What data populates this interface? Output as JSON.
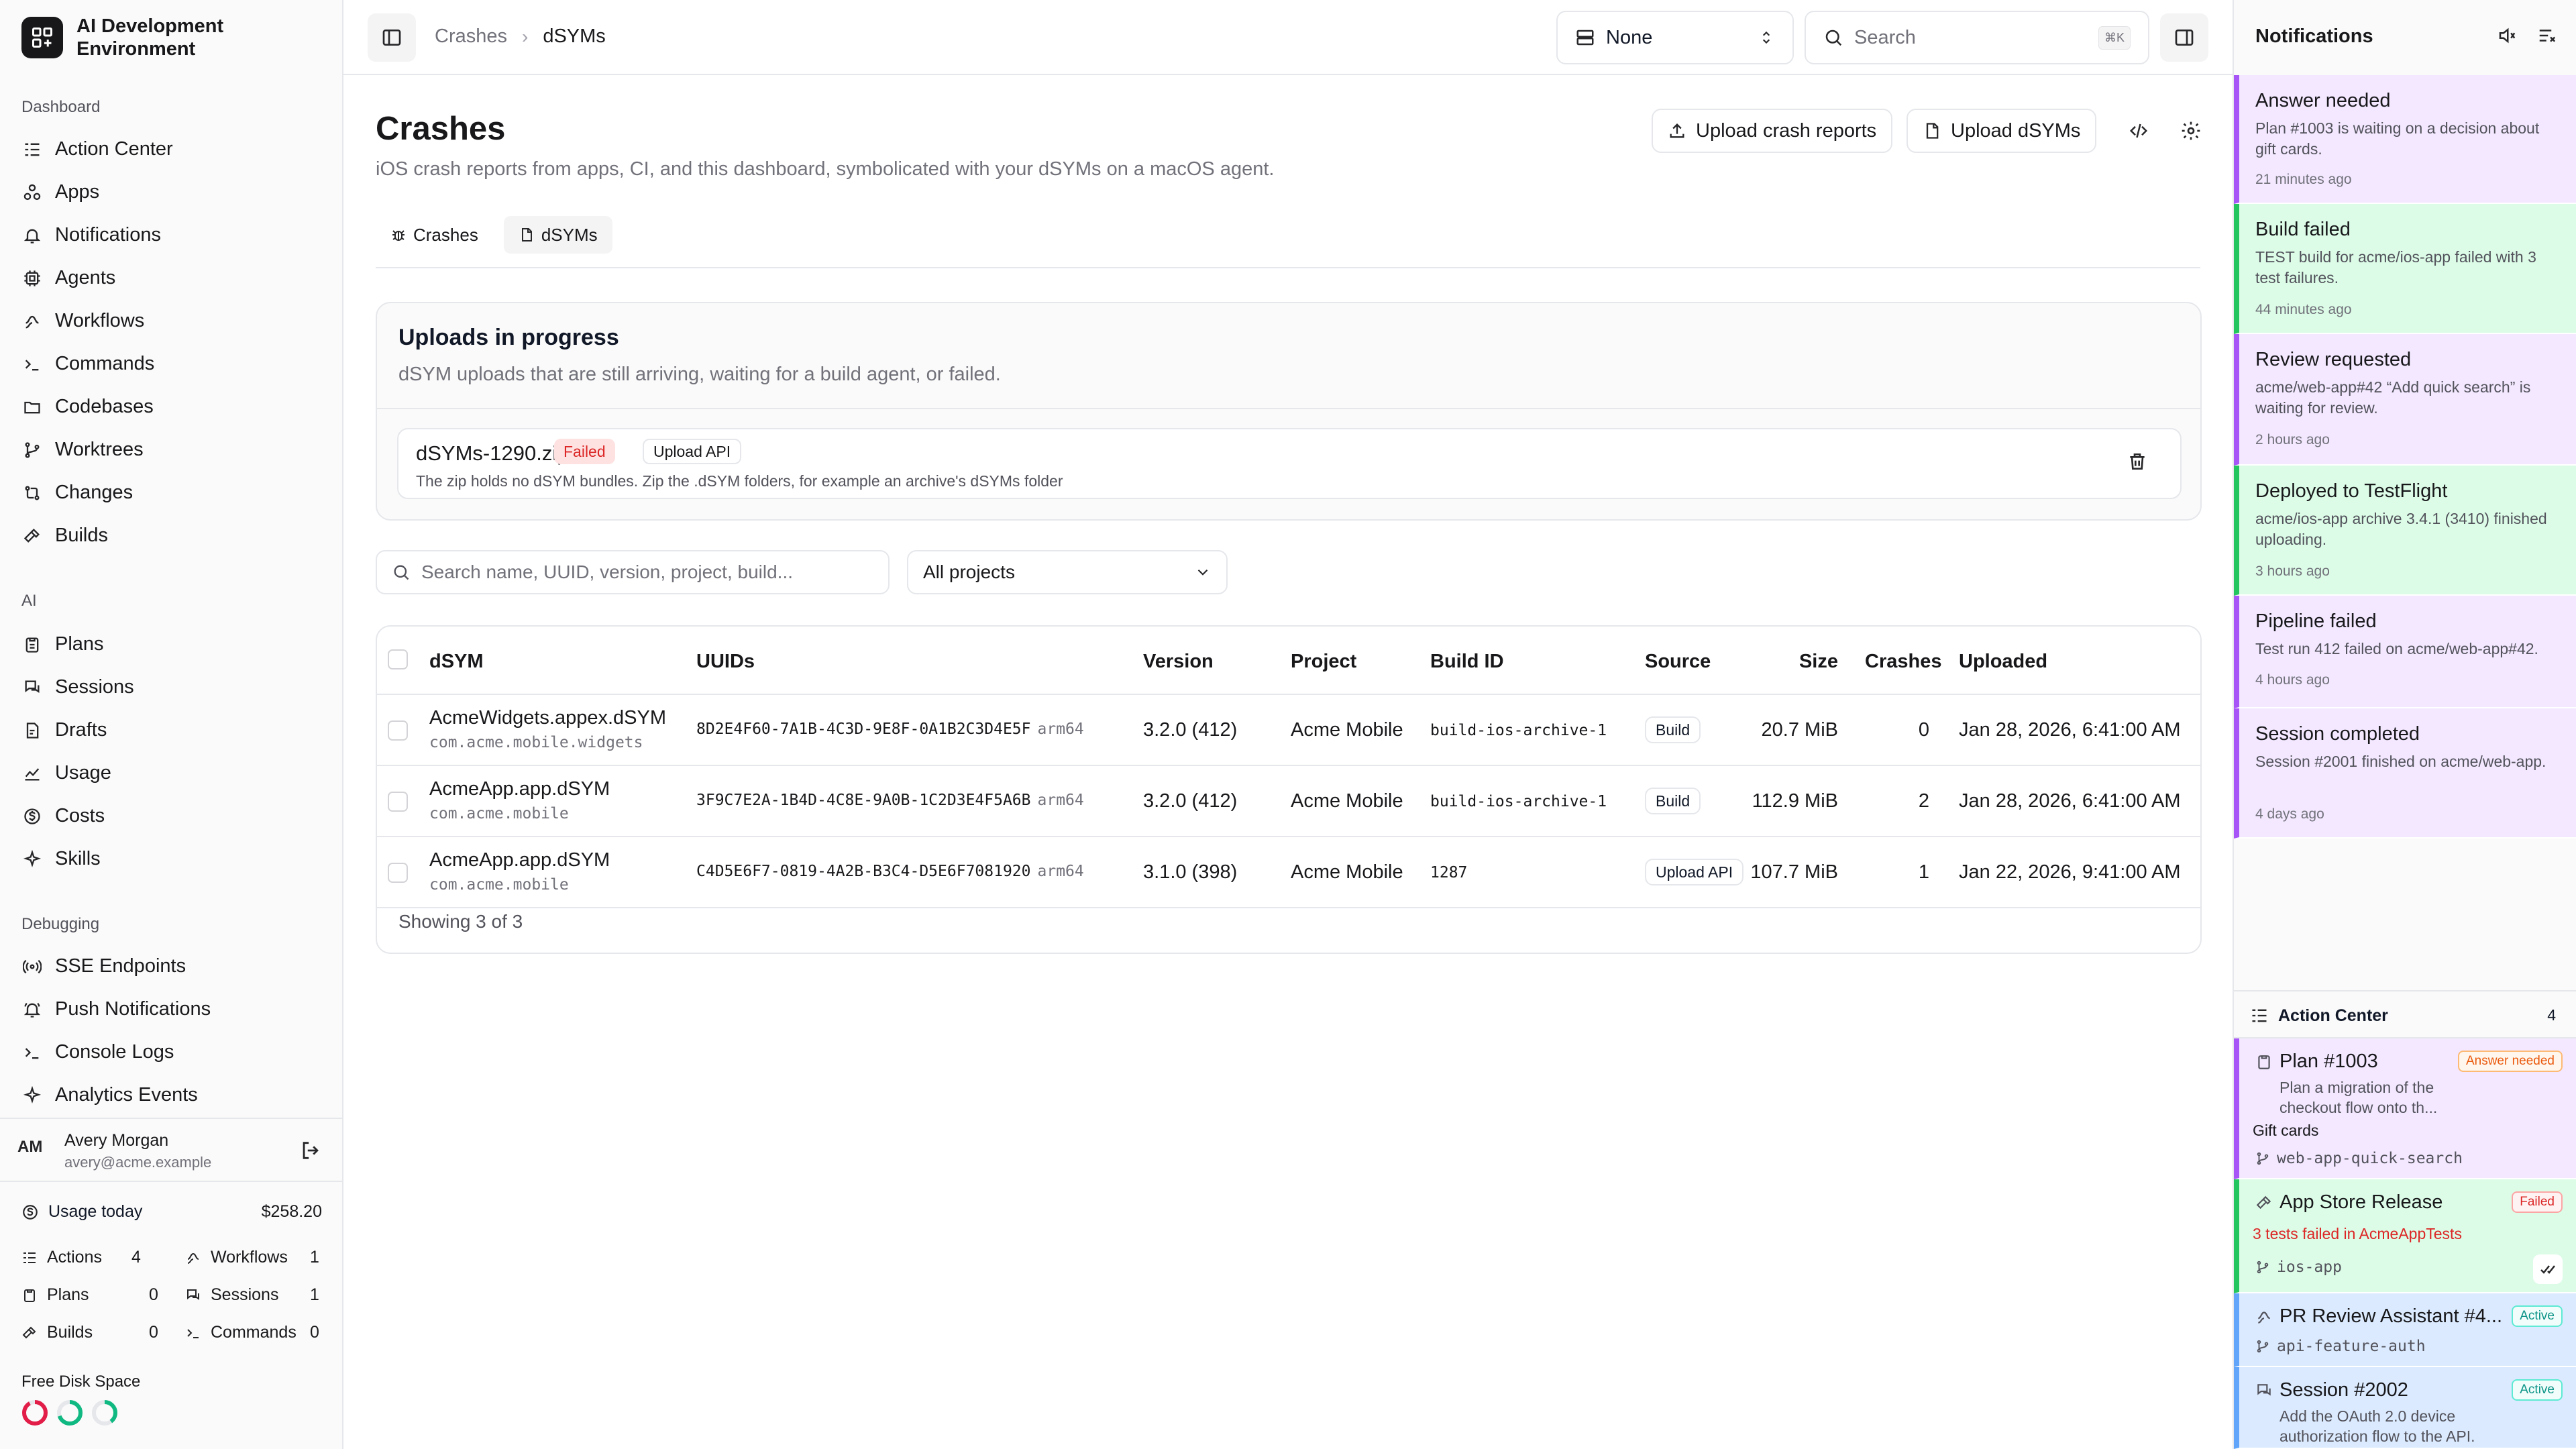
{
  "app": {
    "title": "AI Development Environment"
  },
  "sidebar": {
    "sections": [
      {
        "label": "Dashboard",
        "items": [
          {
            "label": "Action Center",
            "icon": "list-icon"
          },
          {
            "label": "Apps",
            "icon": "apps-icon"
          },
          {
            "label": "Notifications",
            "icon": "bell-icon"
          },
          {
            "label": "Agents",
            "icon": "cpu-icon"
          },
          {
            "label": "Workflows",
            "icon": "workflow-icon"
          },
          {
            "label": "Commands",
            "icon": "terminal-icon"
          },
          {
            "label": "Codebases",
            "icon": "folder-icon"
          },
          {
            "label": "Worktrees",
            "icon": "branch-icon"
          },
          {
            "label": "Changes",
            "icon": "diff-icon"
          },
          {
            "label": "Builds",
            "icon": "hammer-icon"
          }
        ]
      },
      {
        "label": "AI",
        "items": [
          {
            "label": "Plans",
            "icon": "clipboard-icon"
          },
          {
            "label": "Sessions",
            "icon": "chat-icon"
          },
          {
            "label": "Drafts",
            "icon": "draft-icon"
          },
          {
            "label": "Usage",
            "icon": "chart-icon"
          },
          {
            "label": "Costs",
            "icon": "dollar-icon"
          },
          {
            "label": "Skills",
            "icon": "sparkle-icon"
          }
        ]
      },
      {
        "label": "Debugging",
        "items": [
          {
            "label": "SSE Endpoints",
            "icon": "radio-icon"
          },
          {
            "label": "Push Notifications",
            "icon": "bell-ring-icon"
          },
          {
            "label": "Console Logs",
            "icon": "terminal-icon"
          },
          {
            "label": "Analytics Events",
            "icon": "sparkle-icon"
          }
        ]
      }
    ],
    "user": {
      "initials": "AM",
      "name": "Avery Morgan",
      "email": "avery@acme.example"
    },
    "usage": {
      "label": "Usage today",
      "amount": "$258.20"
    },
    "stats": [
      {
        "label": "Actions",
        "value": "4"
      },
      {
        "label": "Workflows",
        "value": "1"
      },
      {
        "label": "Plans",
        "value": "0"
      },
      {
        "label": "Sessions",
        "value": "1"
      },
      {
        "label": "Builds",
        "value": "0"
      },
      {
        "label": "Commands",
        "value": "0"
      }
    ],
    "disk": {
      "label": "Free Disk Space",
      "levels": [
        0.92,
        0.7,
        0.4
      ],
      "colors": [
        "#e11d48",
        "#10b981",
        "#10b981"
      ]
    }
  },
  "topbar": {
    "breadcrumb": [
      "Crashes",
      "dSYMs"
    ],
    "project_select": "None",
    "search_placeholder": "Search",
    "search_shortcut": "⌘K"
  },
  "main": {
    "title": "Crashes",
    "subtitle": "iOS crash reports from apps, CI, and this dashboard, symbolicated with your dSYMs on a macOS agent.",
    "buttons": {
      "upload_crash": "Upload crash reports",
      "upload_dsyms": "Upload dSYMs"
    },
    "tabs": [
      {
        "label": "Crashes",
        "active": false
      },
      {
        "label": "dSYMs",
        "active": true
      }
    ],
    "uploads": {
      "title": "Uploads in progress",
      "description": "dSYM uploads that are still arriving, waiting for a build agent, or failed.",
      "items": [
        {
          "name": "dSYMs-1290.zip",
          "status": "Failed",
          "source": "Upload API",
          "message": "The zip holds no dSYM bundles. Zip the .dSYM folders, for example an archive's dSYMs folder"
        }
      ]
    },
    "filters": {
      "search_placeholder": "Search name, UUID, version, project, build...",
      "project": "All projects"
    },
    "table": {
      "columns": [
        "dSYM",
        "UUIDs",
        "Version",
        "Project",
        "Build ID",
        "Source",
        "Size",
        "Crashes",
        "Uploaded"
      ],
      "rows": [
        {
          "name": "AcmeWidgets.appex.dSYM",
          "bundle": "com.acme.mobile.widgets",
          "uuid": "8D2E4F60-7A1B-4C3D-9E8F-0A1B2C3D4E5F",
          "arch": "arm64",
          "version": "3.2.0 (412)",
          "project": "Acme Mobile",
          "build_id": "build-ios-archive-1",
          "source": "Build",
          "size": "20.7 MiB",
          "crashes": "0",
          "uploaded": "Jan 28, 2026, 6:41:00 AM"
        },
        {
          "name": "AcmeApp.app.dSYM",
          "bundle": "com.acme.mobile",
          "uuid": "3F9C7E2A-1B4D-4C8E-9A0B-1C2D3E4F5A6B",
          "arch": "arm64",
          "version": "3.2.0 (412)",
          "project": "Acme Mobile",
          "build_id": "build-ios-archive-1",
          "source": "Build",
          "size": "112.9 MiB",
          "crashes": "2",
          "uploaded": "Jan 28, 2026, 6:41:00 AM"
        },
        {
          "name": "AcmeApp.app.dSYM",
          "bundle": "com.acme.mobile",
          "uuid": "C4D5E6F7-0819-4A2B-B3C4-D5E6F7081920",
          "arch": "arm64",
          "version": "3.1.0 (398)",
          "project": "Acme Mobile",
          "build_id": "1287",
          "source": "Upload API",
          "size": "107.7 MiB",
          "crashes": "1",
          "uploaded": "Jan 22, 2026, 9:41:00 AM"
        }
      ],
      "footer": "Showing 3 of 3"
    }
  },
  "notifications": {
    "title": "Notifications",
    "items": [
      {
        "title": "Answer needed",
        "body": "Plan #1003 is waiting on a decision about gift cards.",
        "time": "21 minutes ago",
        "color": "purple"
      },
      {
        "title": "Build failed",
        "body": "TEST build for acme/ios-app failed with 3 test failures.",
        "time": "44 minutes ago",
        "color": "green"
      },
      {
        "title": "Review requested",
        "body": "acme/web-app#42 “Add quick search” is waiting for review.",
        "time": "2 hours ago",
        "color": "purple"
      },
      {
        "title": "Deployed to TestFlight",
        "body": "acme/ios-app archive 3.4.1 (3410) finished uploading.",
        "time": "3 hours ago",
        "color": "green"
      },
      {
        "title": "Pipeline failed",
        "body": "Test run 412 failed on acme/web-app#42.",
        "time": "4 hours ago",
        "color": "purple"
      },
      {
        "title": "Session completed",
        "body": "Session #2001 finished on acme/web-app.",
        "time": "4 days ago",
        "color": "purple"
      }
    ]
  },
  "action_center": {
    "title": "Action Center",
    "count": "4",
    "items": [
      {
        "title": "Plan #1003",
        "desc": "Plan a migration of the checkout flow onto th...",
        "extra": "Gift cards",
        "tag": "Answer needed",
        "branch": "web-app-quick-search"
      },
      {
        "title": "App Store Release",
        "desc": "3 tests failed in AcmeAppTests",
        "tag": "Failed",
        "branch": "ios-app"
      },
      {
        "title": "PR Review Assistant #4...",
        "tag": "Active",
        "branch": "api-feature-auth"
      },
      {
        "title": "Session #2002",
        "desc": "Add the OAuth 2.0 device authorization flow to the API.",
        "tag": "Active"
      }
    ]
  }
}
